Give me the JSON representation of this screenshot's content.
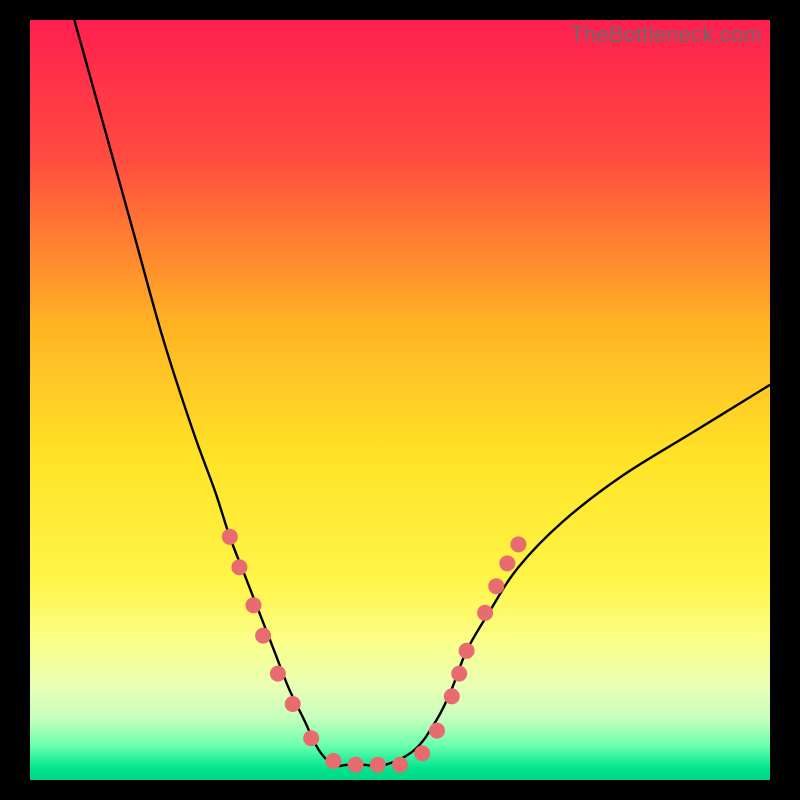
{
  "watermark": "TheBottleneck.com",
  "chart_data": {
    "type": "line",
    "title": "",
    "xlabel": "",
    "ylabel": "",
    "xlim": [
      0,
      100
    ],
    "ylim": [
      0,
      100
    ],
    "background_gradient": {
      "stops": [
        {
          "offset": 0.0,
          "color": "#ff1f4f"
        },
        {
          "offset": 0.18,
          "color": "#ff4b3f"
        },
        {
          "offset": 0.4,
          "color": "#ffb324"
        },
        {
          "offset": 0.58,
          "color": "#ffe427"
        },
        {
          "offset": 0.74,
          "color": "#fff54a"
        },
        {
          "offset": 0.82,
          "color": "#fbff8c"
        },
        {
          "offset": 0.88,
          "color": "#e7ffb6"
        },
        {
          "offset": 0.92,
          "color": "#c4ffbd"
        },
        {
          "offset": 0.955,
          "color": "#6affad"
        },
        {
          "offset": 0.985,
          "color": "#00e58e"
        },
        {
          "offset": 1.0,
          "color": "#00d484"
        }
      ]
    },
    "series": [
      {
        "name": "bottleneck-curve",
        "color": "#000000",
        "x": [
          6,
          10,
          14,
          18,
          22,
          25,
          27,
          29,
          31,
          33,
          35,
          37,
          39,
          41,
          43,
          45,
          48,
          52,
          55,
          57,
          59,
          62,
          66,
          72,
          80,
          90,
          100
        ],
        "y": [
          100,
          86,
          72,
          58,
          46,
          38,
          32,
          27,
          22,
          17,
          12,
          8,
          4,
          2,
          2,
          2,
          2,
          4,
          8,
          12,
          17,
          22,
          28,
          34,
          40,
          46,
          52
        ]
      }
    ],
    "flat_segment": {
      "x_start": 41,
      "x_end": 52,
      "y": 2
    },
    "markers": {
      "color": "#e86b6f",
      "radius": 8,
      "points": [
        {
          "x": 27.0,
          "y": 32
        },
        {
          "x": 28.3,
          "y": 28
        },
        {
          "x": 30.2,
          "y": 23
        },
        {
          "x": 31.5,
          "y": 19
        },
        {
          "x": 33.5,
          "y": 14
        },
        {
          "x": 35.5,
          "y": 10
        },
        {
          "x": 38.0,
          "y": 5.5
        },
        {
          "x": 41.0,
          "y": 2.5
        },
        {
          "x": 44.0,
          "y": 2.0
        },
        {
          "x": 47.0,
          "y": 2.0
        },
        {
          "x": 50.0,
          "y": 2.0
        },
        {
          "x": 53.0,
          "y": 3.5
        },
        {
          "x": 55.0,
          "y": 6.5
        },
        {
          "x": 57.0,
          "y": 11
        },
        {
          "x": 58.0,
          "y": 14
        },
        {
          "x": 59.0,
          "y": 17
        },
        {
          "x": 61.5,
          "y": 22
        },
        {
          "x": 63.0,
          "y": 25.5
        },
        {
          "x": 64.5,
          "y": 28.5
        },
        {
          "x": 66.0,
          "y": 31
        }
      ]
    }
  }
}
